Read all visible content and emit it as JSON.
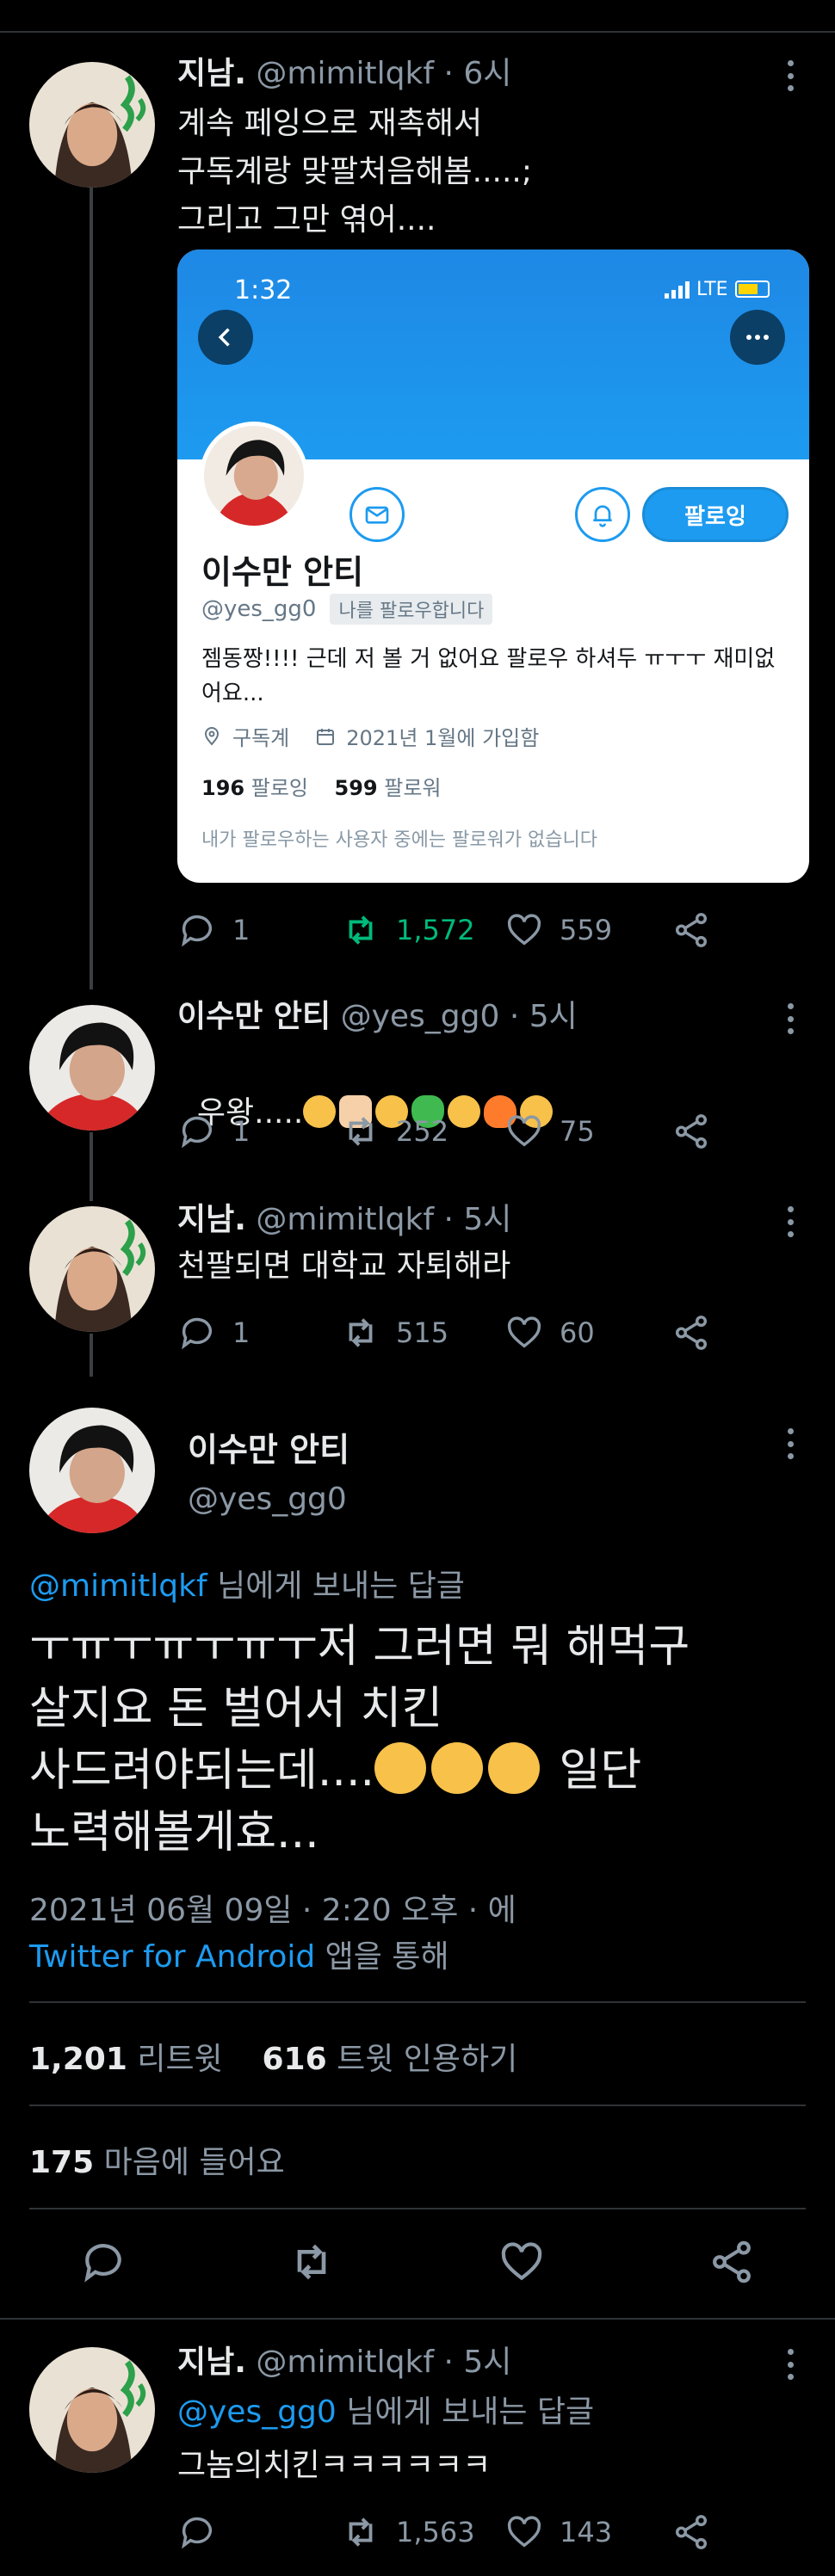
{
  "tweets": [
    {
      "name": "지남.",
      "meta": "@mimitlqkf · 6시",
      "text": "계속 페잉으로 재촉해서\n구독계랑 맞팔처음해봄.....;\n그리고 그만 엮어....",
      "replies": "1",
      "retweets": "1,572",
      "likes": "559"
    },
    {
      "name": "이수만 안티",
      "meta": "@yes_gg0 · 5시",
      "text": "우왕.....",
      "emojis": [
        "#f7c14a",
        "#f5d0a9",
        "#f7c14a",
        "#3fb950",
        "#f7c14a",
        "#ff7b2c",
        "#f7c14a"
      ],
      "replies": "1",
      "retweets": "252",
      "likes": "75"
    },
    {
      "name": "지남.",
      "meta": "@mimitlqkf · 5시",
      "text": "천팔되면 대학교 자퇴해라",
      "replies": "1",
      "retweets": "515",
      "likes": "60"
    }
  ],
  "card": {
    "time": "1:32",
    "network": "LTE",
    "name": "이수만 안티",
    "handle": "@yes_gg0",
    "follows_you": "나를 팔로우합니다",
    "follow_button": "팔로잉",
    "bio": "젬동짱!!!! 근데 저 볼 거 없어요 팔로우 하셔두 ㅠㅜㅜ 재미없\n어요...",
    "location": "구독계",
    "joined": "2021년 1월에 가입함",
    "following_count": "196",
    "following_label": "팔로잉",
    "followers_count": "599",
    "followers_label": "팔로워",
    "footer": "내가 팔로우하는 사용자 중에는 팔로워가 없습니다"
  },
  "focused": {
    "name": "이수만 안티",
    "handle": "@yes_gg0",
    "reply_to": "@mimitlqkf",
    "reply_suffix": " 님에게 보내는 답글",
    "text_line1": "ㅜㅠㅜㅠㅜㅠㅜ저 그러면 뭐 해먹구",
    "text_line2": "살지요 돈 벌어서 치킨",
    "text_line3_a": "사드려야되는데....",
    "text_line3_b": " 일단",
    "text_line4": "노력해볼게효...",
    "emojis": [
      "#f7c14a",
      "#f7c14a",
      "#f7c14a"
    ],
    "date": "2021년 06월 09일 · 2:20 오후 · 에",
    "source": "Twitter for Android",
    "source_suffix": " 앱을 통해",
    "retweet_count": "1,201",
    "retweet_label": " 리트윗",
    "quote_count": "616",
    "quote_label": " 트윗 인용하기",
    "like_count": "175",
    "like_label": " 마음에 들어요"
  },
  "last_reply": {
    "name": "지남.",
    "meta": "@mimitlqkf · 5시",
    "reply_to": "@yes_gg0",
    "reply_suffix": " 님에게 보내는 답글",
    "text": "그놈의치킨ㅋㅋㅋㅋㅋㅋ",
    "retweets": "1,563",
    "likes": "143"
  },
  "colors": {
    "background": "#000000",
    "accent": "#1d9bf0",
    "retweet_active": "#00ba7c",
    "muted": "#8b98a5"
  }
}
